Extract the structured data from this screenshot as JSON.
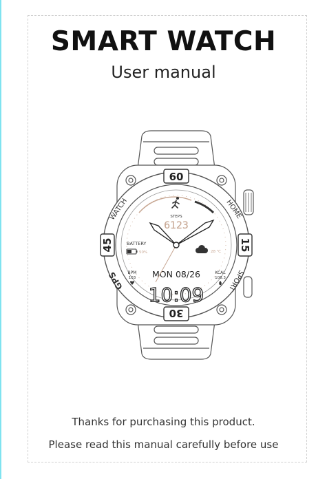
{
  "page": {
    "title": "SMART WATCH",
    "subtitle": "User manual",
    "thanks": "Thanks for purchasing this product.",
    "instruction": "Please read this manual carefully before use"
  },
  "watch": {
    "bezel": {
      "top": "60",
      "bottom": "30",
      "left": "45",
      "right": "15"
    },
    "side_labels": {
      "top_left": "WATCH",
      "top_right": "HOME",
      "bottom_left": "GPS",
      "bottom_right": "SPORT"
    },
    "steps_label": "STEPS",
    "steps_value": "6123",
    "battery_label": "BATTERY",
    "battery_value": "50%",
    "weather_value": "28 ℃",
    "date": "MON 08/26",
    "bpm_label": "BPM",
    "bpm_value": "103",
    "kcal_label": "KCAL",
    "kcal_value": "108.3",
    "time": "10:09",
    "accent_color": "#c8a894"
  }
}
